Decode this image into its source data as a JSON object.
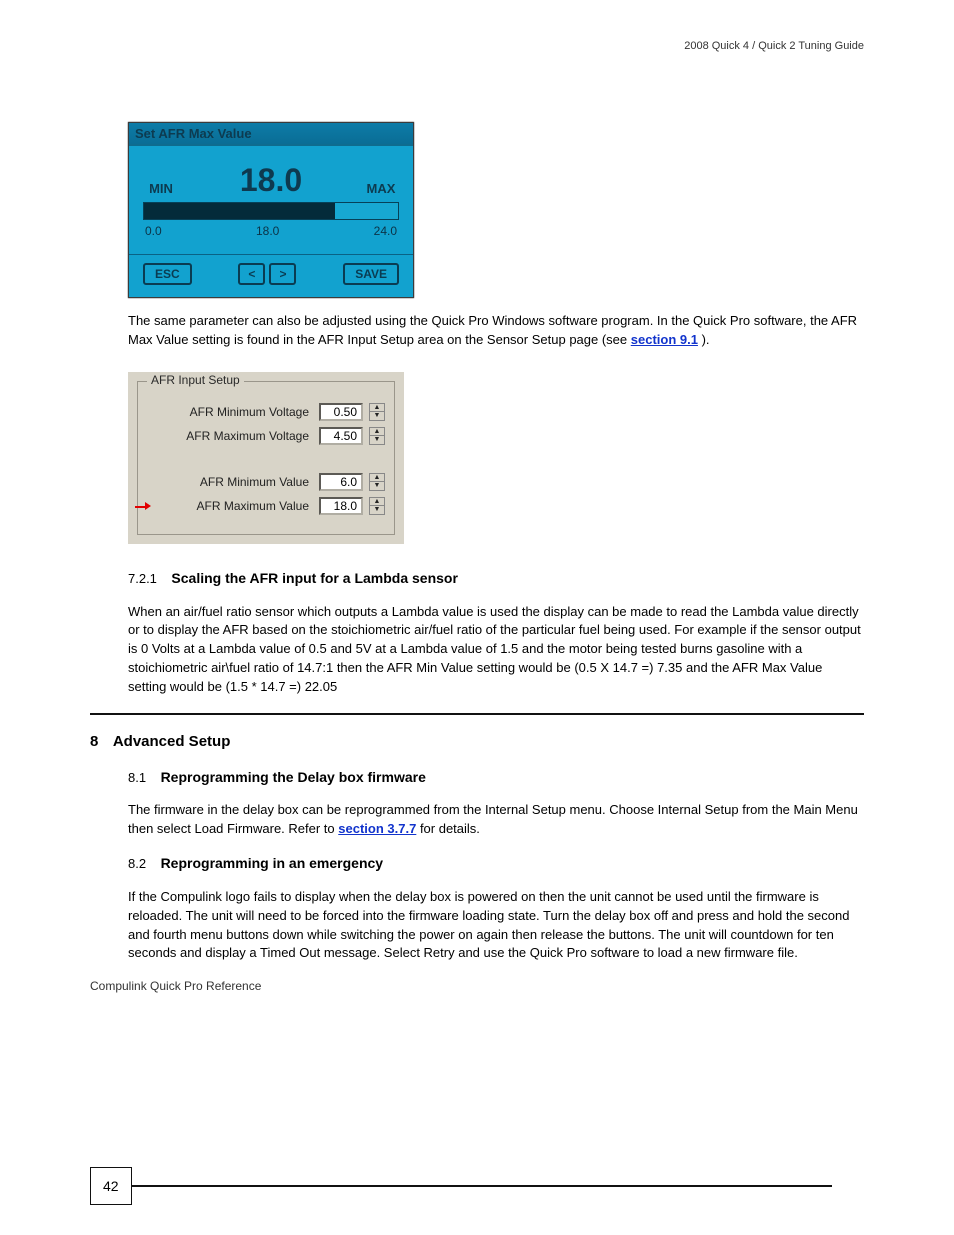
{
  "sensor_panel": {
    "title": "Set AFR Max Value",
    "value": "18.0",
    "min_label": "MIN",
    "max_label": "MAX",
    "scale_min": "0.0",
    "scale_mid": "18.0",
    "scale_max": "24.0",
    "fill_pct": "75%",
    "btn_esc": "ESC",
    "btn_prev": "<",
    "btn_next": ">",
    "btn_save": "SAVE"
  },
  "text": {
    "header_right": "2008 Quick 4 / Quick 2 Tuning Guide",
    "para1_prefix": "The same parameter can also be adjusted using the Quick Pro Windows software program. In the Quick Pro software, the AFR Max Value setting is found in the AFR Input Setup area on the Sensor Setup page (see ",
    "para1_link": "section 9.1",
    "para1_suffix": ")."
  },
  "afr_panel": {
    "legend": "AFR Input Setup",
    "rows": [
      {
        "label": "AFR Minimum Voltage",
        "value": "0.50"
      },
      {
        "label": "AFR Maximum Voltage",
        "value": "4.50"
      },
      {
        "label": "AFR Minimum Value",
        "value": "6.0"
      },
      {
        "label": "AFR Maximum Value",
        "value": "18.0",
        "highlight": true
      }
    ]
  },
  "sections": {
    "s721_num": "7.2.1",
    "s721_title": "Scaling the AFR input for a Lambda sensor",
    "s721_body": "When an air/fuel ratio sensor which outputs a Lambda value is used the display can be made to read the Lambda value directly or to display the AFR based on the stoichiometric air/fuel ratio of the particular fuel being used. For example if the sensor output is 0 Volts at a Lambda value of 0.5 and 5V at a Lambda value of 1.5 and the motor being tested burns gasoline with a stoichiometric air\\fuel ratio of 14.7:1 then the AFR Min Value setting would be (0.5 X 14.7 =) 7.35 and the AFR Max Value setting would be (1.5 * 14.7 =) 22.05",
    "s8_num": "8",
    "s8_title": "Advanced Setup",
    "s81_num": "8.1",
    "s81_title": "Reprogramming the Delay box firmware",
    "s81_body_prefix": "The firmware in the delay box can be reprogrammed from the Internal Setup menu. Choose Internal Setup from the Main Menu then select Load Firmware. Refer to ",
    "s81_link": "section 3.7.7",
    "s81_suffix": " for details.",
    "s82_num": "8.2",
    "s82_title": "Reprogramming in an emergency",
    "s82_body": "If the Compulink logo fails to display when the delay box is powered on then the unit cannot be used until the firmware is reloaded. The unit will need to be forced into the firmware loading state. Turn the delay box off and press and hold the second and fourth menu buttons down while switching the power on again then release the buttons. The unit will countdown for ten seconds and display a Timed Out message. Select Retry and use the Quick Pro software to load a new firmware file."
  },
  "footer": {
    "page_num": "42",
    "brand": "Compulink Quick Pro Reference"
  }
}
